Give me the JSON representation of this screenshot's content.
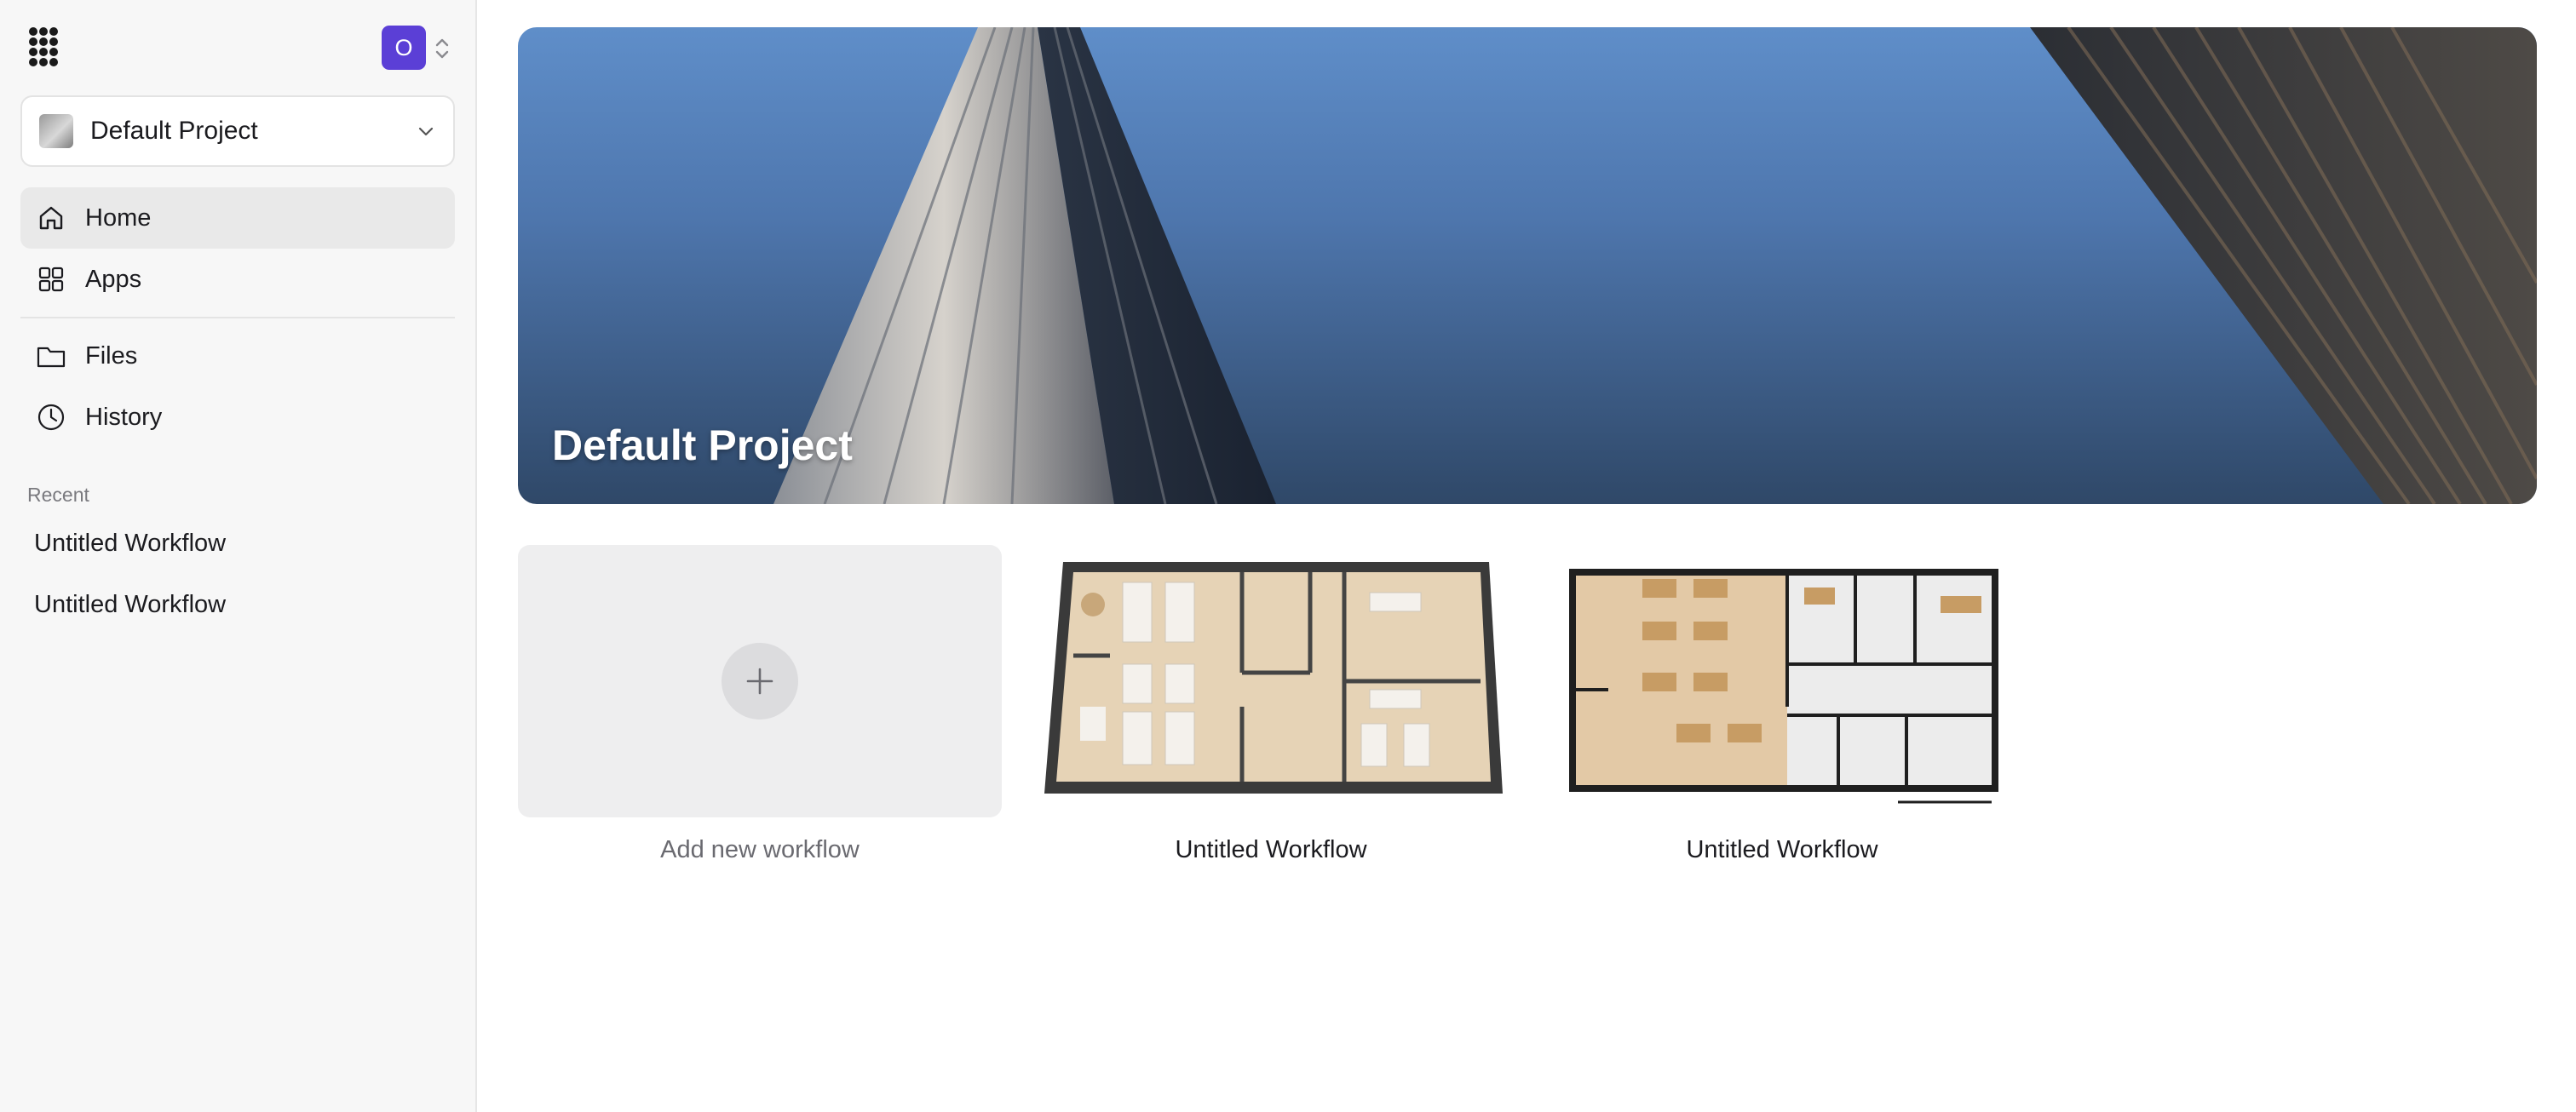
{
  "sidebar": {
    "logo": "logo-icon",
    "avatar_initial": "O",
    "project_select": {
      "label": "Default Project",
      "icon": "chevron-down-icon"
    },
    "nav": [
      {
        "label": "Home",
        "icon": "home-icon",
        "active": true
      },
      {
        "label": "Apps",
        "icon": "grid-icon",
        "active": false
      },
      {
        "label": "Files",
        "icon": "folder-icon",
        "active": false
      },
      {
        "label": "History",
        "icon": "clock-icon",
        "active": false
      }
    ],
    "recent_heading": "Recent",
    "recent": [
      {
        "label": "Untitled Workflow"
      },
      {
        "label": "Untitled Workflow"
      }
    ]
  },
  "main": {
    "banner_title": "Default Project",
    "cards": [
      {
        "caption": "Add new workflow",
        "icon": "plus-icon"
      },
      {
        "caption": "Untitled Workflow"
      },
      {
        "caption": "Untitled Workflow"
      }
    ]
  },
  "colors": {
    "accent": "#5b3fd6",
    "sidebar_bg": "#f7f7f7",
    "active_nav_bg": "#e9e9e9"
  }
}
